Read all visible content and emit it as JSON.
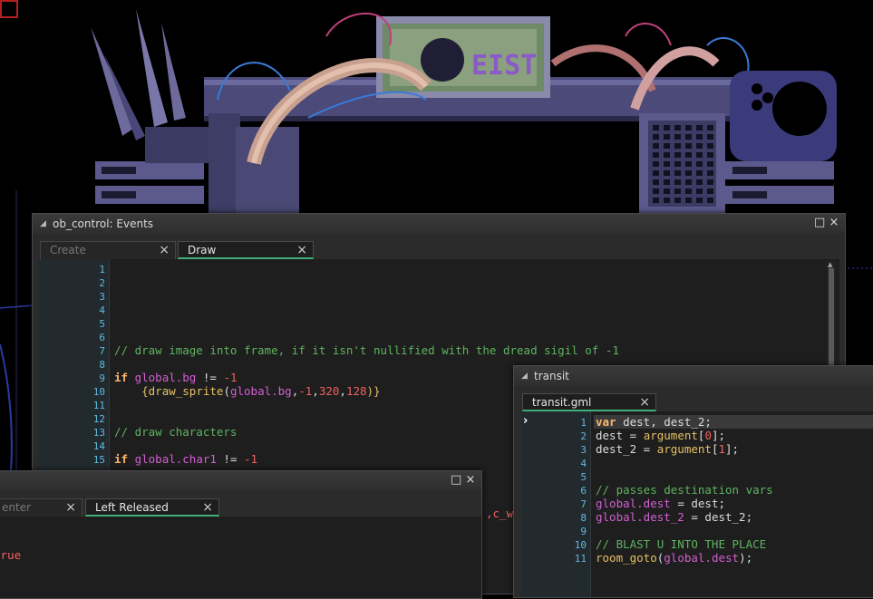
{
  "win_events": {
    "title": "ob_control: Events",
    "tabs": [
      {
        "label": "Create",
        "active": false
      },
      {
        "label": "Draw",
        "active": true
      }
    ],
    "line_numbers": [
      "1",
      "2",
      "3",
      "4",
      "5",
      "6",
      "7",
      "8",
      "9",
      "10",
      "11",
      "12",
      "13",
      "14",
      "15"
    ],
    "comment1": "// draw image into frame, if it isn't nullified with the dread sigil of -1",
    "l9_if": "if",
    "l9_global": "global.bg",
    "l9_op": " != ",
    "l9_num": "-1",
    "l10_open": "    {",
    "l10_fn": "draw_sprite",
    "l10_paren": "(",
    "l10_global": "global.bg",
    "l10_comma1": ",",
    "l10_num1": "-1",
    "l10_comma2": ",",
    "l10_num2": "320",
    "l10_comma3": ",",
    "l10_num3": "128",
    "l10_close": ")}",
    "comment2": "// draw characters",
    "l15_if": "if",
    "l15_global": "global.char1",
    "l15_op": " != ",
    "l15_num": "-1"
  },
  "win_mouse": {
    "tabs": [
      {
        "label": "enter",
        "active": false
      },
      {
        "label": "Left Released",
        "active": true
      }
    ],
    "code_fragment": "true",
    "behind_fragment": ",c_w"
  },
  "win_transit": {
    "title": "transit",
    "tabs": [
      {
        "label": "transit.gml",
        "active": true
      }
    ],
    "line_numbers": [
      "1",
      "2",
      "3",
      "4",
      "5",
      "6",
      "7",
      "8",
      "9",
      "10",
      "11"
    ],
    "current_line_marker": "›",
    "l1_kw": "var",
    "l1_rest": " dest, dest_2;",
    "l2_a": "dest = ",
    "l2_b": "argument",
    "l2_c": "[",
    "l2_d": "0",
    "l2_e": "];",
    "l3_a": "dest_2 = ",
    "l3_b": "argument",
    "l3_c": "[",
    "l3_d": "1",
    "l3_e": "];",
    "comment1": "// passes destination vars",
    "l7_g": "global.dest",
    "l7_rest": " = dest;",
    "l8_g": "global.dest_2",
    "l8_rest": " = dest_2;",
    "comment2": "// BLAST U INTO THE PLACE",
    "l11_fn": "room_goto",
    "l11_open": "(",
    "l11_g": "global.dest",
    "l11_close": ");"
  },
  "icons": {
    "close": "×",
    "maximize": "□",
    "collapse": "◢"
  },
  "colors": {
    "accent_tab": "#3fae7a",
    "line_numbers": "#5fb8e0",
    "keyword": "#ffb86c",
    "global_var": "#d25fd1",
    "function": "#e5c062",
    "number": "#f06060",
    "comment": "#5fb35f"
  }
}
